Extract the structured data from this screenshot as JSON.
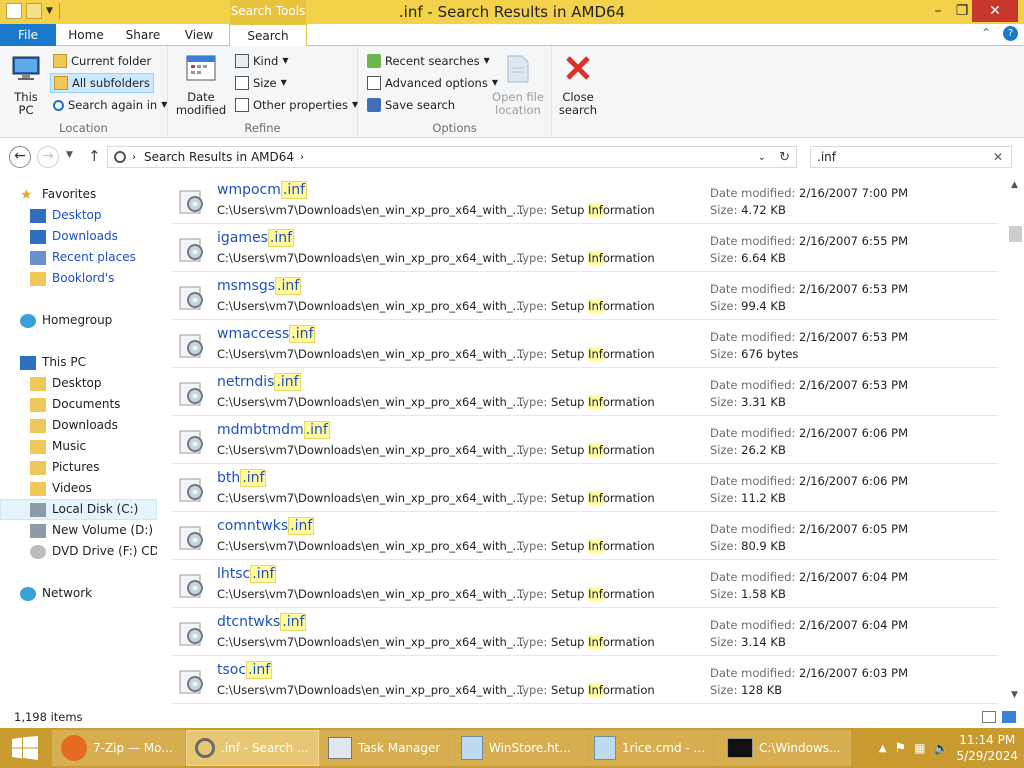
{
  "window": {
    "title": ".inf - Search Results in AMD64",
    "context_tab": "Search Tools"
  },
  "ribbon_tabs": [
    "File",
    "Home",
    "Share",
    "View",
    "Search"
  ],
  "ribbon": {
    "location": {
      "label": "Location",
      "this_pc": "This PC",
      "current_folder": "Current folder",
      "all_subfolders": "All subfolders",
      "search_again": "Search again in"
    },
    "refine": {
      "label": "Refine",
      "date_modified": "Date modified",
      "kind": "Kind",
      "size": "Size",
      "other_properties": "Other properties"
    },
    "options": {
      "label": "Options",
      "recent_searches": "Recent searches",
      "advanced_options": "Advanced options",
      "save_search": "Save search",
      "open_file_location": "Open file location"
    },
    "close_search": "Close search"
  },
  "address": {
    "breadcrumb": "Search Results in AMD64",
    "search_value": ".inf"
  },
  "nav": {
    "favorites": "Favorites",
    "desktop": "Desktop",
    "downloads": "Downloads",
    "recent_places": "Recent places",
    "booklord": "Booklord's",
    "homegroup": "Homegroup",
    "this_pc": "This PC",
    "pc_desktop": "Desktop",
    "documents": "Documents",
    "pc_downloads": "Downloads",
    "music": "Music",
    "pictures": "Pictures",
    "videos": "Videos",
    "local_disk": "Local Disk (C:)",
    "new_volume": "New Volume (D:)",
    "dvd_drive": "DVD Drive (F:) CD_R",
    "network": "Network"
  },
  "labels": {
    "type": "Type:",
    "type_pre": "Setup ",
    "type_hl": "Inf",
    "type_post": "ormation",
    "date_modified": "Date modified:",
    "size": "Size:",
    "path": "C:\\Users\\vm7\\Downloads\\en_win_xp_pro_x64_with_..."
  },
  "results": [
    {
      "base": "wmpocm",
      "ext": ".inf",
      "date": "2/16/2007 7:00 PM",
      "size": "4.72 KB"
    },
    {
      "base": "igames",
      "ext": ".inf",
      "date": "2/16/2007 6:55 PM",
      "size": "6.64 KB"
    },
    {
      "base": "msmsgs",
      "ext": ".inf",
      "date": "2/16/2007 6:53 PM",
      "size": "99.4 KB"
    },
    {
      "base": "wmaccess",
      "ext": ".inf",
      "date": "2/16/2007 6:53 PM",
      "size": "676 bytes"
    },
    {
      "base": "netrndis",
      "ext": ".inf",
      "date": "2/16/2007 6:53 PM",
      "size": "3.31 KB"
    },
    {
      "base": "mdmbtmdm",
      "ext": ".inf",
      "date": "2/16/2007 6:06 PM",
      "size": "26.2 KB"
    },
    {
      "base": "bth",
      "ext": ".inf",
      "date": "2/16/2007 6:06 PM",
      "size": "11.2 KB"
    },
    {
      "base": "comntwks",
      "ext": ".inf",
      "date": "2/16/2007 6:05 PM",
      "size": "80.9 KB"
    },
    {
      "base": "lhtsc",
      "ext": ".inf",
      "date": "2/16/2007 6:04 PM",
      "size": "1.58 KB"
    },
    {
      "base": "dtcntwks",
      "ext": ".inf",
      "date": "2/16/2007 6:04 PM",
      "size": "3.14 KB"
    },
    {
      "base": "tsoc",
      "ext": ".inf",
      "date": "2/16/2007 6:03 PM",
      "size": "128 KB"
    }
  ],
  "status": {
    "item_count": "1,198 items"
  },
  "taskbar": {
    "items": [
      "7-Zip — Mo...",
      ".inf - Search ...",
      "Task Manager",
      "WinStore.ht...",
      "1rice.cmd - ...",
      "C:\\Windows..."
    ],
    "time": "11:14 PM",
    "date": "5/29/2024"
  }
}
